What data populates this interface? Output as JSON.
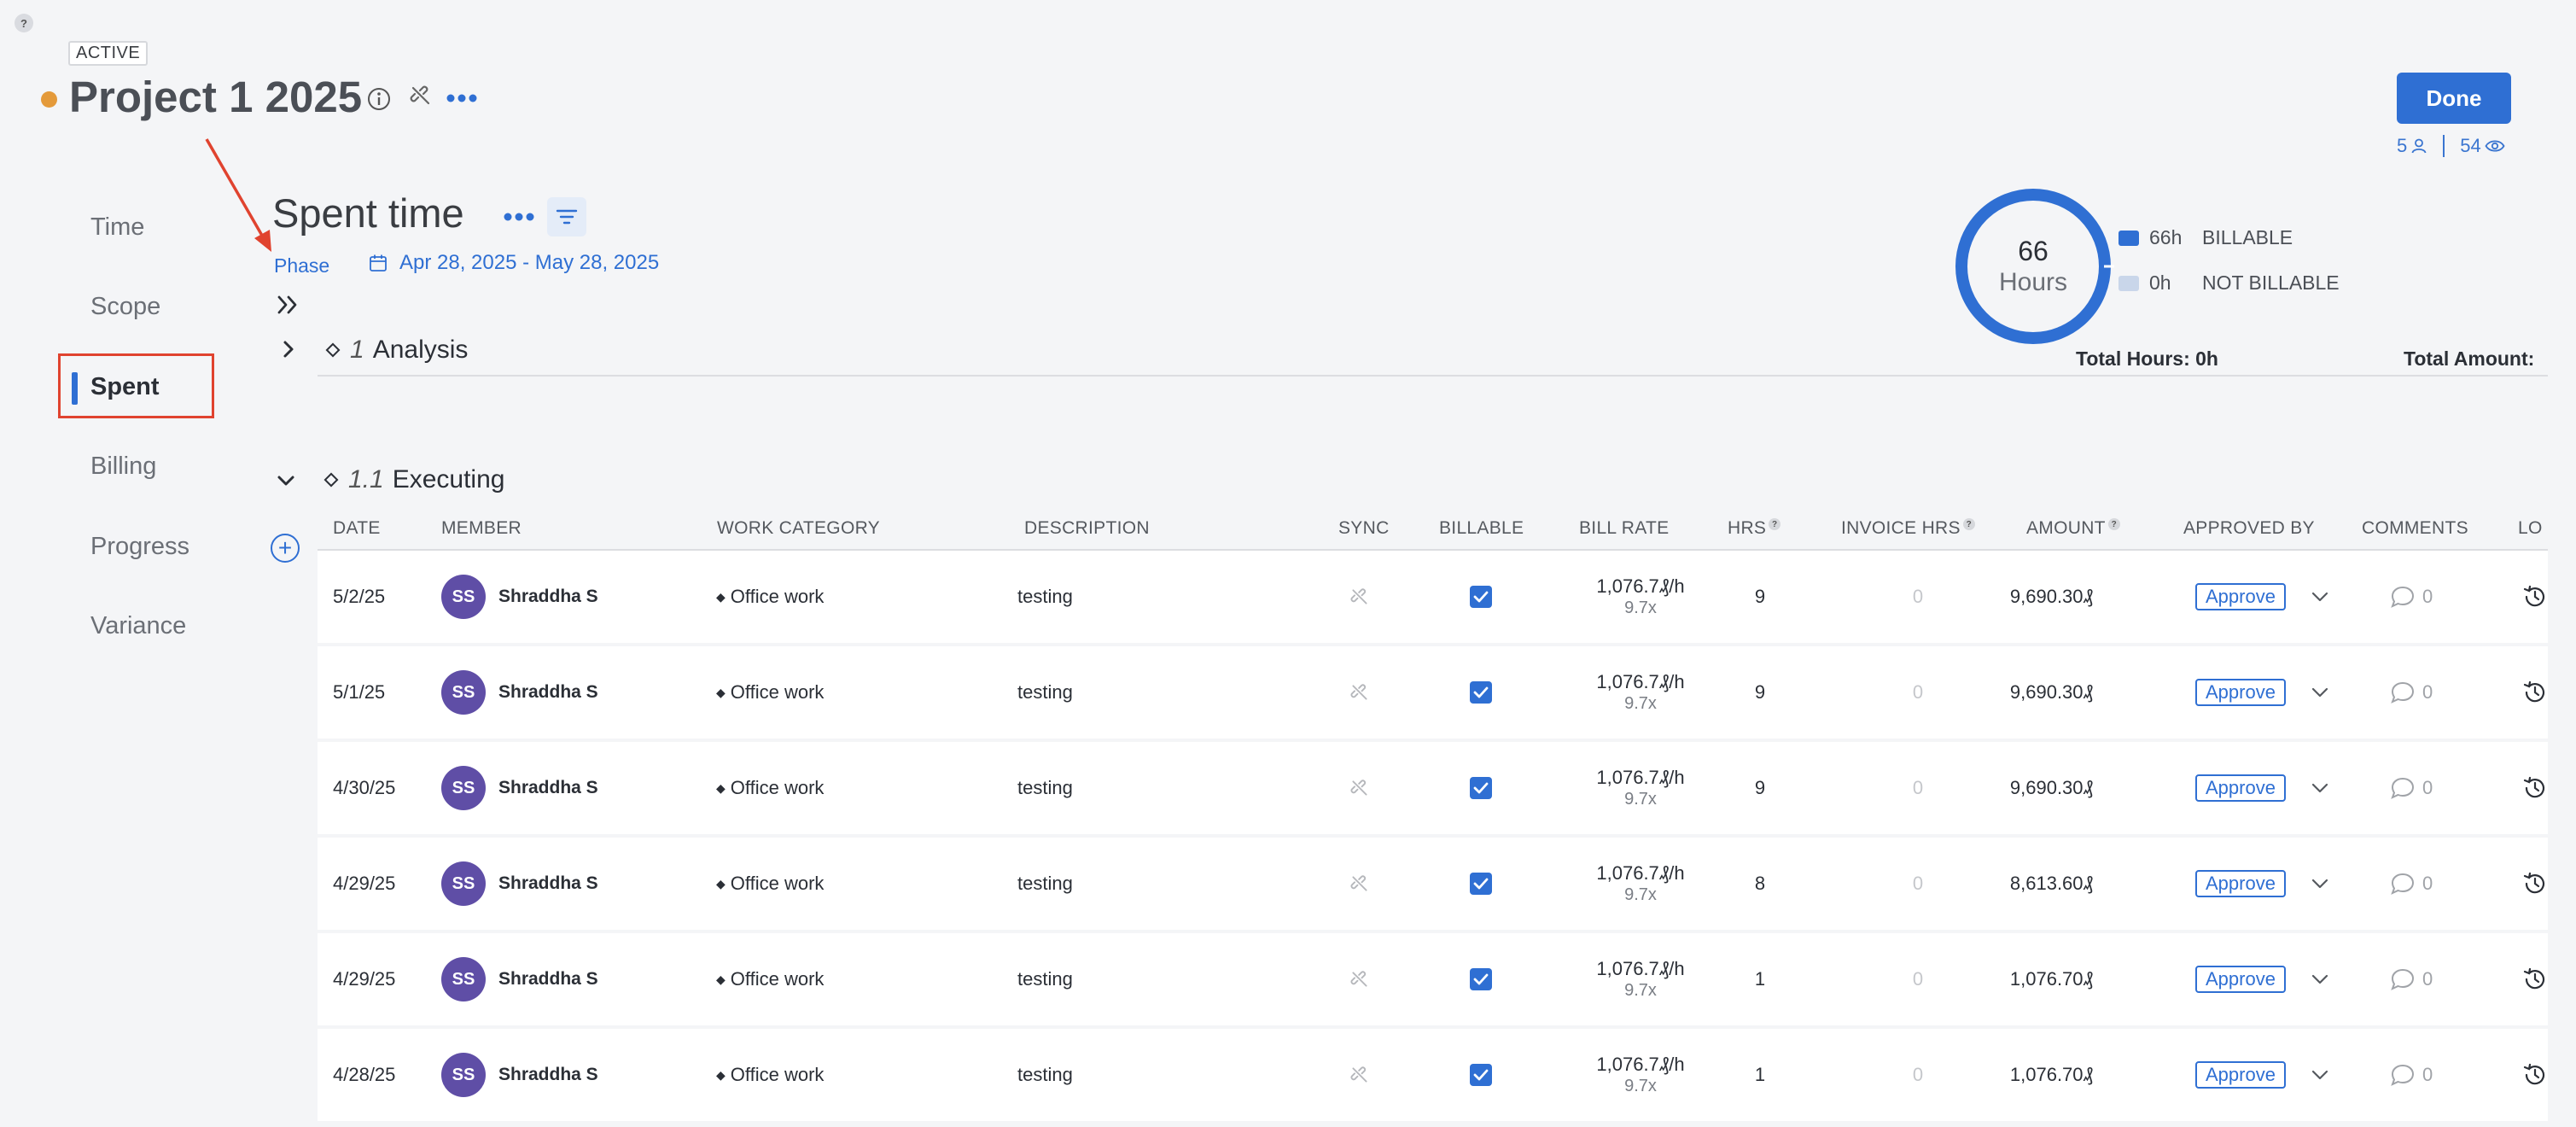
{
  "help_label": "?",
  "project": {
    "status": "ACTIVE",
    "status_color": "#e49a3a",
    "title": "Project 1 2025"
  },
  "header": {
    "done_label": "Done",
    "members_count": "5",
    "views_count": "54"
  },
  "nav": {
    "items": [
      {
        "label": "Time"
      },
      {
        "label": "Scope"
      },
      {
        "label": "Spent"
      },
      {
        "label": "Billing"
      },
      {
        "label": "Progress"
      },
      {
        "label": "Variance"
      }
    ],
    "active": "Spent"
  },
  "section": {
    "title": "Spent time",
    "phase_label": "Phase",
    "date_range": "Apr 28, 2025 - May 28, 2025"
  },
  "summary": {
    "donut_value": "66",
    "donut_unit": "Hours",
    "billable_value": "66h",
    "billable_label": "BILLABLE",
    "billable_color": "#2f6fd3",
    "not_billable_value": "0h",
    "not_billable_label": "NOT BILLABLE",
    "not_billable_color": "#c9d6ea",
    "total_hours": "Total Hours: 0h",
    "total_amount": "Total Amount:"
  },
  "phases": [
    {
      "number": "1",
      "name": "Analysis",
      "expanded": false
    },
    {
      "number": "1.1",
      "name": "Executing",
      "expanded": true
    }
  ],
  "table": {
    "headers": {
      "date": "DATE",
      "member": "MEMBER",
      "work_category": "WORK CATEGORY",
      "description": "DESCRIPTION",
      "sync": "SYNC",
      "billable": "BILLABLE",
      "bill_rate": "BILL RATE",
      "hrs": "HRS",
      "invoice_hrs": "INVOICE HRS",
      "amount": "AMOUNT",
      "approved_by": "APPROVED BY",
      "comments": "COMMENTS",
      "log": "LO"
    },
    "rows": [
      {
        "date": "5/2/25",
        "initials": "SS",
        "member": "Shraddha S",
        "category": "Office work",
        "description": "testing",
        "rate": "1,076.7₰/h",
        "multiplier": "9.7x",
        "hrs": "9",
        "invoice_hrs": "0",
        "amount": "9,690.30₰",
        "approve": "Approve",
        "comments": "0"
      },
      {
        "date": "5/1/25",
        "initials": "SS",
        "member": "Shraddha S",
        "category": "Office work",
        "description": "testing",
        "rate": "1,076.7₰/h",
        "multiplier": "9.7x",
        "hrs": "9",
        "invoice_hrs": "0",
        "amount": "9,690.30₰",
        "approve": "Approve",
        "comments": "0"
      },
      {
        "date": "4/30/25",
        "initials": "SS",
        "member": "Shraddha S",
        "category": "Office work",
        "description": "testing",
        "rate": "1,076.7₰/h",
        "multiplier": "9.7x",
        "hrs": "9",
        "invoice_hrs": "0",
        "amount": "9,690.30₰",
        "approve": "Approve",
        "comments": "0"
      },
      {
        "date": "4/29/25",
        "initials": "SS",
        "member": "Shraddha S",
        "category": "Office work",
        "description": "testing",
        "rate": "1,076.7₰/h",
        "multiplier": "9.7x",
        "hrs": "8",
        "invoice_hrs": "0",
        "amount": "8,613.60₰",
        "approve": "Approve",
        "comments": "0"
      },
      {
        "date": "4/29/25",
        "initials": "SS",
        "member": "Shraddha S",
        "category": "Office work",
        "description": "testing",
        "rate": "1,076.7₰/h",
        "multiplier": "9.7x",
        "hrs": "1",
        "invoice_hrs": "0",
        "amount": "1,076.70₰",
        "approve": "Approve",
        "comments": "0"
      },
      {
        "date": "4/28/25",
        "initials": "SS",
        "member": "Shraddha S",
        "category": "Office work",
        "description": "testing",
        "rate": "1,076.7₰/h",
        "multiplier": "9.7x",
        "hrs": "1",
        "invoice_hrs": "0",
        "amount": "1,076.70₰",
        "approve": "Approve",
        "comments": "0"
      }
    ]
  },
  "icons": [
    "help-icon",
    "info-icon",
    "unlink-icon",
    "more-icon",
    "user-icon",
    "eye-icon",
    "filter-icon",
    "calendar-icon",
    "expand-all-icon",
    "chevron-right-icon",
    "chevron-down-icon",
    "diamond-icon",
    "plus-icon",
    "sync-icon",
    "checkbox-checked-icon",
    "comment-icon",
    "history-icon"
  ],
  "accent_color": "#2f6fd3",
  "annotation_color": "#e0432f"
}
